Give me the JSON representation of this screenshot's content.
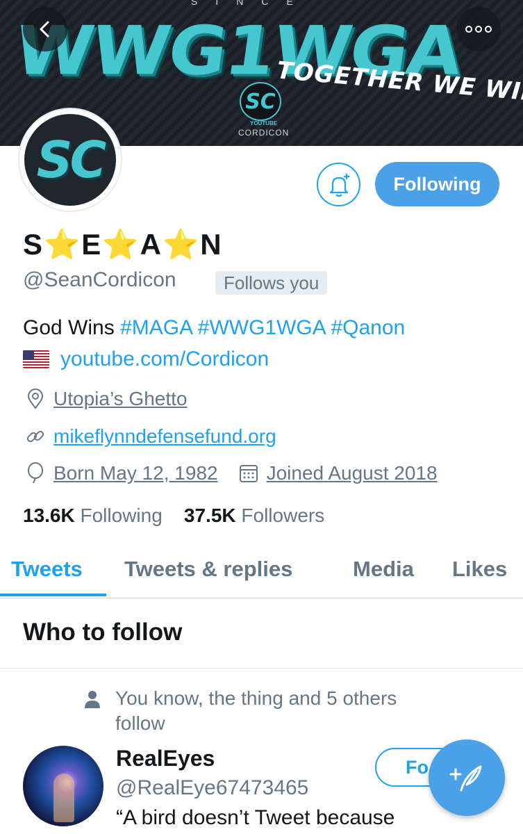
{
  "banner": {
    "since_text": "SINCE",
    "title": "WWG1WGA",
    "tagline": "TOGETHER WE WIN",
    "logo_text": "SC",
    "logo_caption": "YOUTUBE",
    "logo_name": "CORDICON"
  },
  "header": {
    "back_icon": "chevron-left-icon",
    "more_icon": "more-dots-icon"
  },
  "profile": {
    "avatar_text": "SC",
    "notify_icon": "bell-plus-icon",
    "following_label": "Following",
    "display_name": "S⭐E⭐A⭐N",
    "handle": "@SeanCordicon",
    "follows_you": "Follows you",
    "bio_prefix": "God Wins",
    "hashtags": [
      "#MAGA",
      "#WWG1WGA",
      "#Qanon"
    ],
    "bio_link": "youtube.com/Cordicon",
    "location": "Utopia’s  Ghetto",
    "website": "mikeflynndefensefund.org",
    "birthday": "Born May 12, 1982",
    "joined": "Joined August 2018",
    "following_count": "13.6K",
    "following_label2": "Following",
    "followers_count": "37.5K",
    "followers_label": "Followers"
  },
  "tabs": [
    {
      "label": "Tweets",
      "active": true
    },
    {
      "label": "Tweets & replies",
      "active": false
    },
    {
      "label": "Media",
      "active": false
    },
    {
      "label": "Likes",
      "active": false
    }
  ],
  "who_to_follow": {
    "title": "Who to follow",
    "social_context": "You know, the thing and 5 others follow",
    "name": "RealEyes",
    "handle": "@RealEye67473465",
    "bio": "“A bird doesn’t Tweet because",
    "follow_label": "Fo"
  },
  "colors": {
    "accent": "#1da1f2",
    "button_fill": "#4aa1e8",
    "banner_teal": "#46c7cf"
  }
}
